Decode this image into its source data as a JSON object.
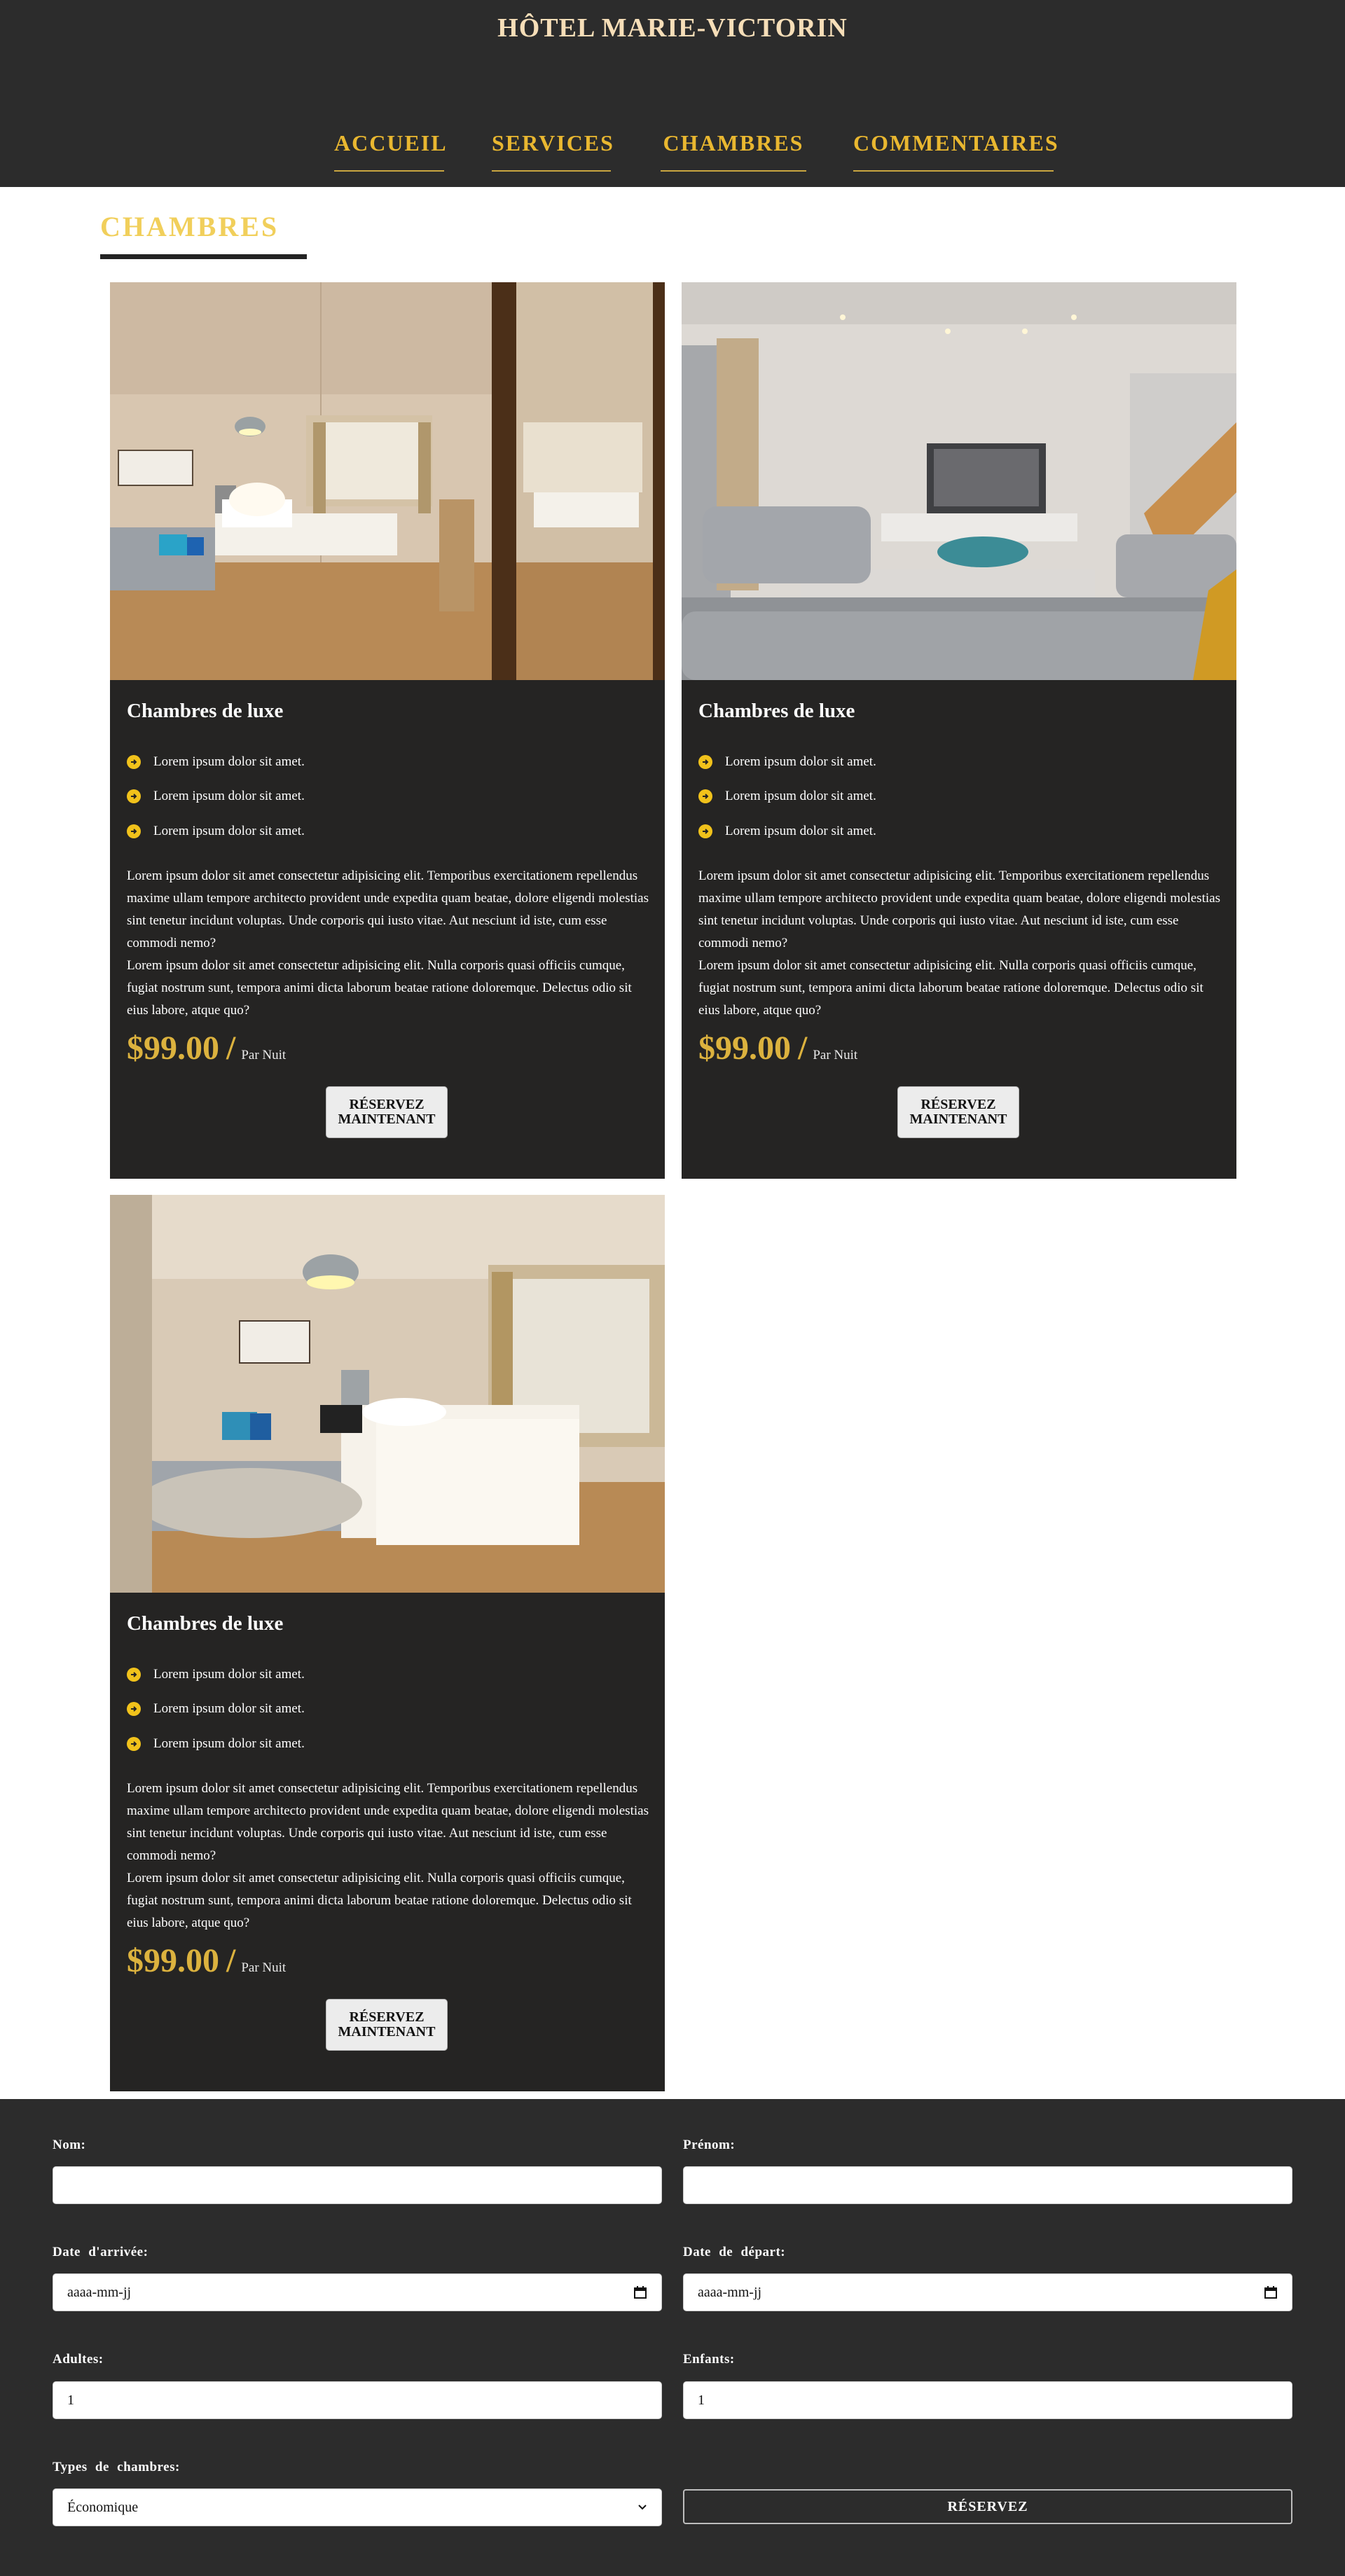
{
  "header": {
    "site_title": "HÔTEL MARIE-VICTORIN",
    "nav": [
      "ACCUEIL",
      "SERVICES",
      "CHAMBRES",
      "COMMENTAIRES"
    ]
  },
  "section": {
    "title": "CHAMBRES"
  },
  "rooms": [
    {
      "title": "Chambres de luxe",
      "features": [
        "Lorem ipsum dolor sit amet.",
        "Lorem ipsum dolor sit amet.",
        "Lorem ipsum dolor sit amet."
      ],
      "description_1": "Lorem ipsum dolor sit amet consectetur adipisicing elit. Temporibus exercitationem repellendus maxime ullam tempore architecto provident unde expedita quam beatae, dolore eligendi molestias sint tenetur incidunt voluptas. Unde corporis qui iusto vitae. Aut nesciunt id iste, cum esse commodi nemo?",
      "description_2": "Lorem ipsum dolor sit amet consectetur adipisicing elit. Nulla corporis quasi officiis cumque, fugiat nostrum sunt, tempora animi dicta laborum beatae ratione doloremque. Delectus odio sit eius labore, atque quo?",
      "price": "$99.00",
      "price_slash": "/",
      "price_unit": "Par Nuit",
      "button": "RÉSERVEZ MAINTENANT"
    },
    {
      "title": "Chambres de luxe",
      "features": [
        "Lorem ipsum dolor sit amet.",
        "Lorem ipsum dolor sit amet.",
        "Lorem ipsum dolor sit amet."
      ],
      "description_1": "Lorem ipsum dolor sit amet consectetur adipisicing elit. Temporibus exercitationem repellendus maxime ullam tempore architecto provident unde expedita quam beatae, dolore eligendi molestias sint tenetur incidunt voluptas. Unde corporis qui iusto vitae. Aut nesciunt id iste, cum esse commodi nemo?",
      "description_2": "Lorem ipsum dolor sit amet consectetur adipisicing elit. Nulla corporis quasi officiis cumque, fugiat nostrum sunt, tempora animi dicta laborum beatae ratione doloremque. Delectus odio sit eius labore, atque quo?",
      "price": "$99.00",
      "price_slash": "/",
      "price_unit": "Par Nuit",
      "button": "RÉSERVEZ MAINTENANT"
    },
    {
      "title": "Chambres de luxe",
      "features": [
        "Lorem ipsum dolor sit amet.",
        "Lorem ipsum dolor sit amet.",
        "Lorem ipsum dolor sit amet."
      ],
      "description_1": "Lorem ipsum dolor sit amet consectetur adipisicing elit. Temporibus exercitationem repellendus maxime ullam tempore architecto provident unde expedita quam beatae, dolore eligendi molestias sint tenetur incidunt voluptas. Unde corporis qui iusto vitae. Aut nesciunt id iste, cum esse commodi nemo?",
      "description_2": "Lorem ipsum dolor sit amet consectetur adipisicing elit. Nulla corporis quasi officiis cumque, fugiat nostrum sunt, tempora animi dicta laborum beatae ratione doloremque. Delectus odio sit eius labore, atque quo?",
      "price": "$99.00",
      "price_slash": "/",
      "price_unit": "Par Nuit",
      "button": "RÉSERVEZ MAINTENANT"
    }
  ],
  "form": {
    "nom_label": "Nom:",
    "nom_value": "",
    "prenom_label": "Prénom:",
    "prenom_value": "",
    "arrivee_label": "Date d'arrivée:",
    "arrivee_value": "aaaa-mm-jj",
    "depart_label": "Date de départ:",
    "depart_value": "aaaa-mm-jj",
    "adultes_label": "Adultes:",
    "adultes_value": "1",
    "enfants_label": "Enfants:",
    "enfants_value": "1",
    "types_label": "Types de chambres:",
    "types_value": "Économique",
    "submit": "RÉSERVEZ"
  },
  "colors": {
    "header_bg": "#2c2c2c",
    "accent_gold": "#e9b730",
    "card_bg": "#252423",
    "feature_icon": "#f1c21b"
  },
  "icons": {
    "feature": "arrow-right-circle-icon",
    "date": "calendar-icon",
    "select": "chevron-down-icon"
  }
}
